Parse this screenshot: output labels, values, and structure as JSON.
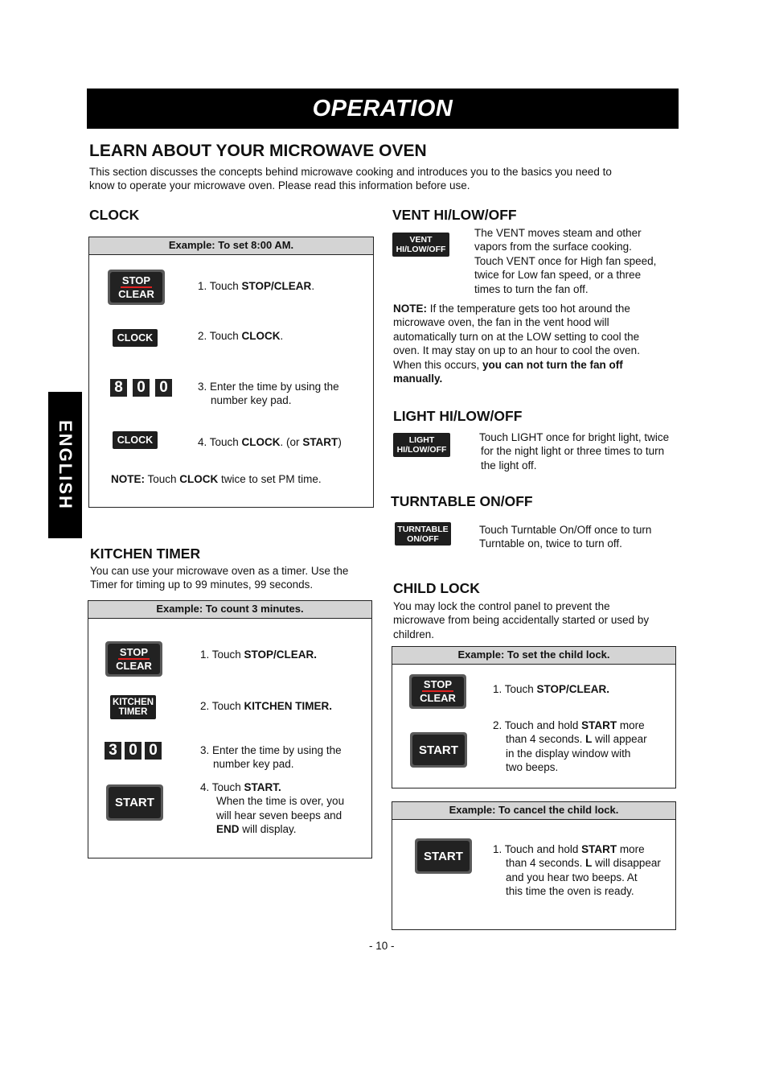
{
  "banner": {
    "title": "OPERATION"
  },
  "side_tab": {
    "label": "ENGLISH"
  },
  "intro": {
    "title": "LEARN ABOUT YOUR MICROWAVE OVEN",
    "text_line1": "This section discusses the concepts behind microwave cooking and introduces you to the basics you need to",
    "text_line2": "know to operate your microwave oven. Please read this information before use."
  },
  "clock": {
    "title": "CLOCK",
    "example_title": "Example: To set 8:00 AM.",
    "buttons": {
      "stop_top": "STOP",
      "stop_bottom": "CLEAR",
      "clock": "CLOCK",
      "digits": [
        "8",
        "0",
        "0"
      ]
    },
    "steps": [
      {
        "prefix": "1. Touch ",
        "bold": "STOP/CLEAR",
        "suffix": "."
      },
      {
        "prefix": "2. Touch ",
        "bold": "CLOCK",
        "suffix": "."
      },
      {
        "line1": "3. Enter the time by using the",
        "line2": "number key pad."
      },
      {
        "prefix": "4. Touch ",
        "bold": "CLOCK",
        "mid": ". (or ",
        "bold2": "START",
        "suffix": ")"
      }
    ],
    "note": {
      "label": "NOTE:",
      "prefix": " Touch ",
      "bold": "CLOCK",
      "suffix": " twice to set PM time."
    }
  },
  "kitchen_timer": {
    "title": "KITCHEN TIMER",
    "desc_line1": "You can use your microwave oven as a timer. Use the",
    "desc_line2": "Timer for timing up to 99 minutes, 99 seconds.",
    "example_title": "Example: To count 3 minutes.",
    "buttons": {
      "stop_top": "STOP",
      "stop_bottom": "CLEAR",
      "timer_top": "KITCHEN",
      "timer_bottom": "TIMER",
      "digits": [
        "3",
        "0",
        "0"
      ],
      "start": "START"
    },
    "steps": [
      {
        "prefix": "1. Touch ",
        "bold": "STOP/CLEAR."
      },
      {
        "prefix": "2. Touch ",
        "bold": "KITCHEN TIMER."
      },
      {
        "line1": "3. Enter the time by using the",
        "line2": "number key pad."
      },
      {
        "prefix": "4. Touch ",
        "bold": "START.",
        "line2": "When the time is over, you",
        "line3": "will hear seven beeps and",
        "line4_bold": "END",
        "line4_rest": " will display."
      }
    ]
  },
  "vent": {
    "title": "VENT HI/LOW/OFF",
    "button_top": "VENT",
    "button_bottom": "HI/LOW/OFF",
    "desc": [
      "The VENT moves steam and other",
      "vapors  from the surface cooking.",
      "Touch VENT once for High fan speed,",
      "twice for Low fan speed, or a three",
      "times to turn the fan off."
    ],
    "note_label": "NOTE:",
    "note_l1": " If the temperature gets too hot around the",
    "note_l2": "microwave oven, the fan in the vent hood will",
    "note_l3": "automatically turn on at the LOW setting to cool the",
    "note_l4": "oven. It may stay on up to an hour to cool the oven.",
    "note_l5_prefix": "When this occurs, ",
    "note_l5_bold": "you can not turn the fan off",
    "note_l6_bold": "manually."
  },
  "light": {
    "title": "LIGHT HI/LOW/OFF",
    "button_top": "LIGHT",
    "button_bottom": "HI/LOW/OFF",
    "desc": [
      "Touch LIGHT once for bright light, twice",
      "for the night light or three times to turn",
      "the light off."
    ]
  },
  "turntable": {
    "title": "TURNTABLE ON/OFF",
    "button_top": "TURNTABLE",
    "button_bottom": "ON/OFF",
    "desc": [
      "Touch Turntable On/Off once to turn",
      "Turntable on, twice to turn off."
    ]
  },
  "child_lock": {
    "title": "CHILD LOCK",
    "desc": [
      "You may lock the control panel to prevent the",
      "microwave from being accidentally started or used by",
      "children."
    ],
    "set_example_title": "Example: To set the child lock.",
    "cancel_example_title": "Example: To cancel the child lock.",
    "buttons": {
      "stop_top": "STOP",
      "stop_bottom": "CLEAR",
      "start": "START"
    },
    "set_steps": [
      {
        "prefix": "1. Touch ",
        "bold": "STOP/CLEAR."
      },
      {
        "prefix": "2. Touch and hold ",
        "bold": "START",
        "suffix": " more",
        "line2_prefix": "than 4 seconds. ",
        "line2_bold": "L",
        "line2_suffix": " will appear",
        "line3": "in the display window with",
        "line4": "two beeps."
      }
    ],
    "cancel_steps": [
      {
        "prefix": "1.  Touch and hold ",
        "bold": "START",
        "suffix": "  more",
        "line2_prefix": "than 4 seconds. ",
        "line2_bold": "L",
        "line2_suffix": " will disappear",
        "line3": "and you hear two beeps. At",
        "line4": "this time the oven is ready."
      }
    ]
  },
  "footer": {
    "page_number": "- 10 -"
  }
}
